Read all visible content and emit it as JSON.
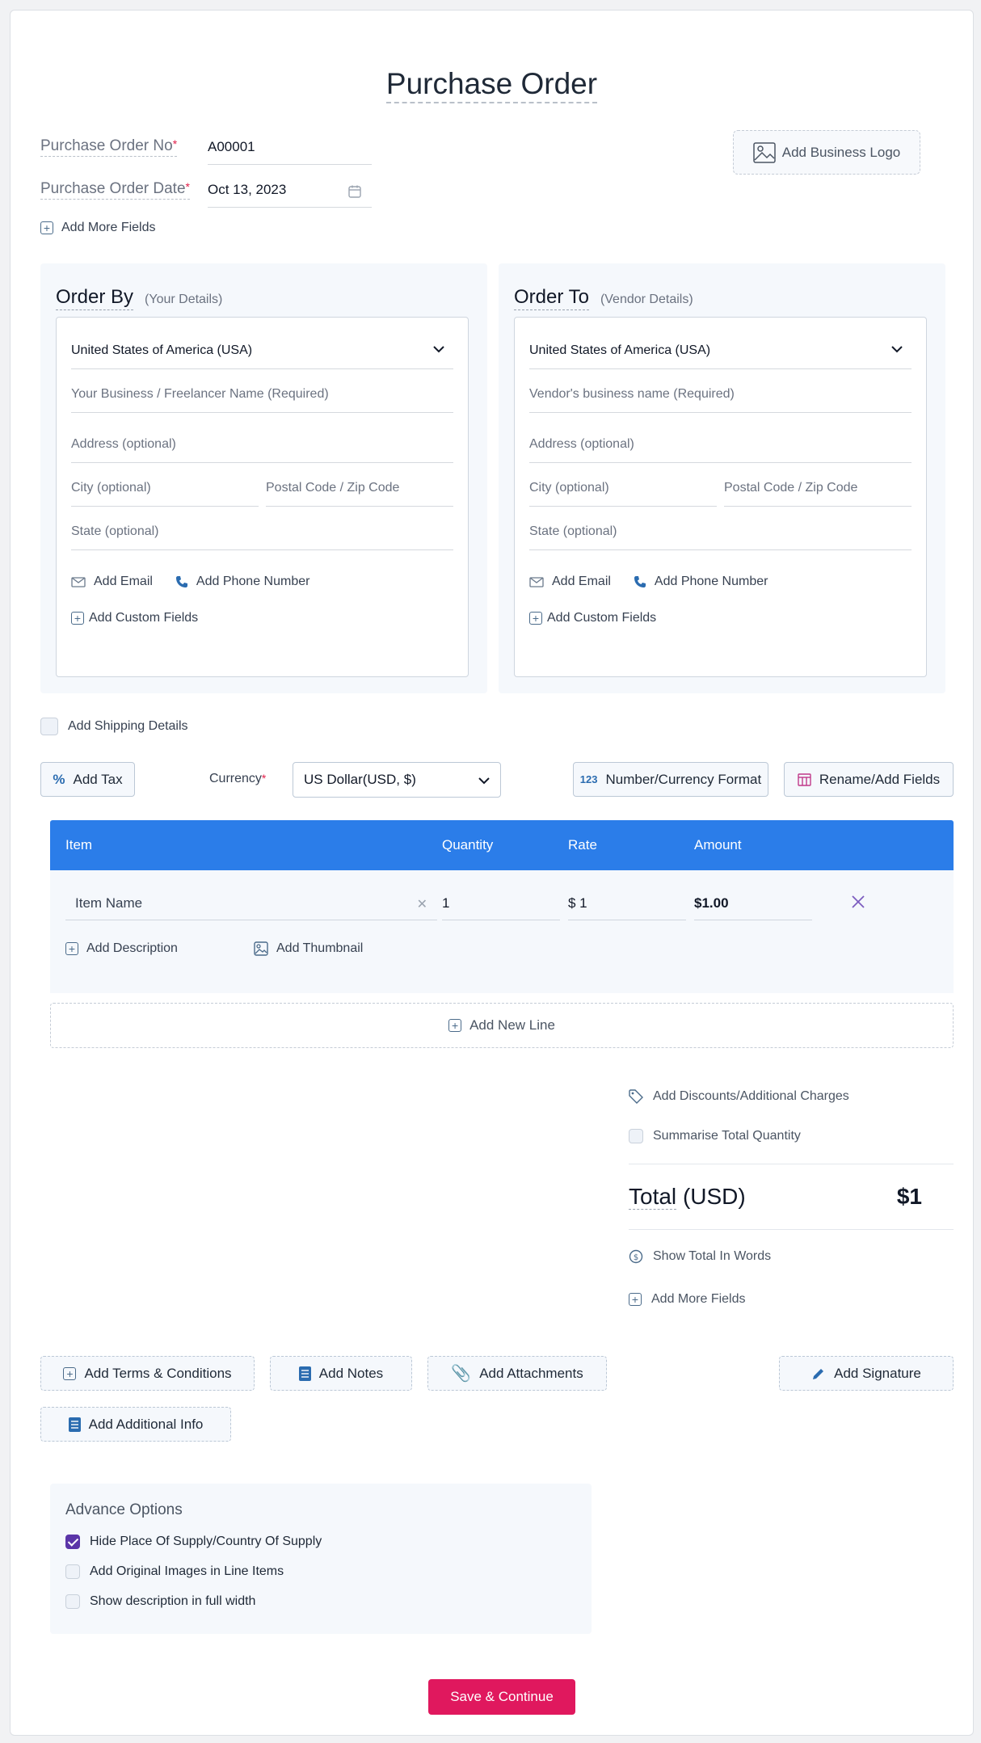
{
  "title": "Purchase Order",
  "meta": {
    "po_no_label": "Purchase Order No",
    "po_no_value": "A00001",
    "po_date_label": "Purchase Order Date",
    "po_date_value": "Oct 13, 2023",
    "required_mark": "*",
    "add_more_fields": "Add More Fields",
    "add_logo": "Add Business Logo"
  },
  "order_by": {
    "heading": "Order By",
    "sub": "(Your Details)",
    "country": "United States of America (USA)",
    "name_placeholder": "Your Business / Freelancer Name (Required)",
    "address_placeholder": "Address (optional)",
    "city_placeholder": "City (optional)",
    "postal_placeholder": "Postal Code / Zip Code",
    "state_placeholder": "State (optional)",
    "add_email": "Add Email",
    "add_phone": "Add Phone Number",
    "add_custom": "Add Custom Fields"
  },
  "order_to": {
    "heading": "Order To",
    "sub": "(Vendor Details)",
    "country": "United States of America (USA)",
    "name_placeholder": "Vendor's business name (Required)",
    "address_placeholder": "Address (optional)",
    "city_placeholder": "City (optional)",
    "postal_placeholder": "Postal Code / Zip Code",
    "state_placeholder": "State (optional)",
    "add_email": "Add Email",
    "add_phone": "Add Phone Number",
    "add_custom": "Add Custom Fields"
  },
  "shipping": {
    "label": "Add Shipping Details",
    "checked": false
  },
  "toolbar": {
    "add_tax": "Add Tax",
    "currency_label": "Currency",
    "currency_value": "US Dollar(USD, $)",
    "number_format_icon": "123",
    "number_format": "Number/Currency Format",
    "rename_fields": "Rename/Add Fields"
  },
  "table": {
    "headers": [
      "Item",
      "Quantity",
      "Rate",
      "Amount"
    ],
    "rows": [
      {
        "item": "Item Name",
        "quantity": "1",
        "rate": "$ 1",
        "amount": "$1.00"
      }
    ],
    "add_description": "Add Description",
    "add_thumbnail": "Add Thumbnail",
    "add_new_line": "Add New Line"
  },
  "summary": {
    "add_discounts": "Add Discounts/Additional Charges",
    "summarise_qty": "Summarise Total Quantity",
    "total_label": "Total",
    "total_currency": "(USD)",
    "total_value": "$1",
    "show_words": "Show Total In Words",
    "add_more_fields": "Add More Fields"
  },
  "extras": {
    "terms": "Add Terms & Conditions",
    "notes": "Add Notes",
    "attachments": "Add Attachments",
    "signature": "Add Signature",
    "additional_info": "Add Additional Info"
  },
  "advance": {
    "title": "Advance Options",
    "options": [
      {
        "label": "Hide Place Of Supply/Country Of Supply",
        "checked": true
      },
      {
        "label": "Add Original Images in Line Items",
        "checked": false
      },
      {
        "label": "Show description in full width",
        "checked": false
      }
    ]
  },
  "save_button": "Save & Continue",
  "colors": {
    "primary": "#2b7de9",
    "save": "#e0185e",
    "check": "#5b35a8"
  }
}
